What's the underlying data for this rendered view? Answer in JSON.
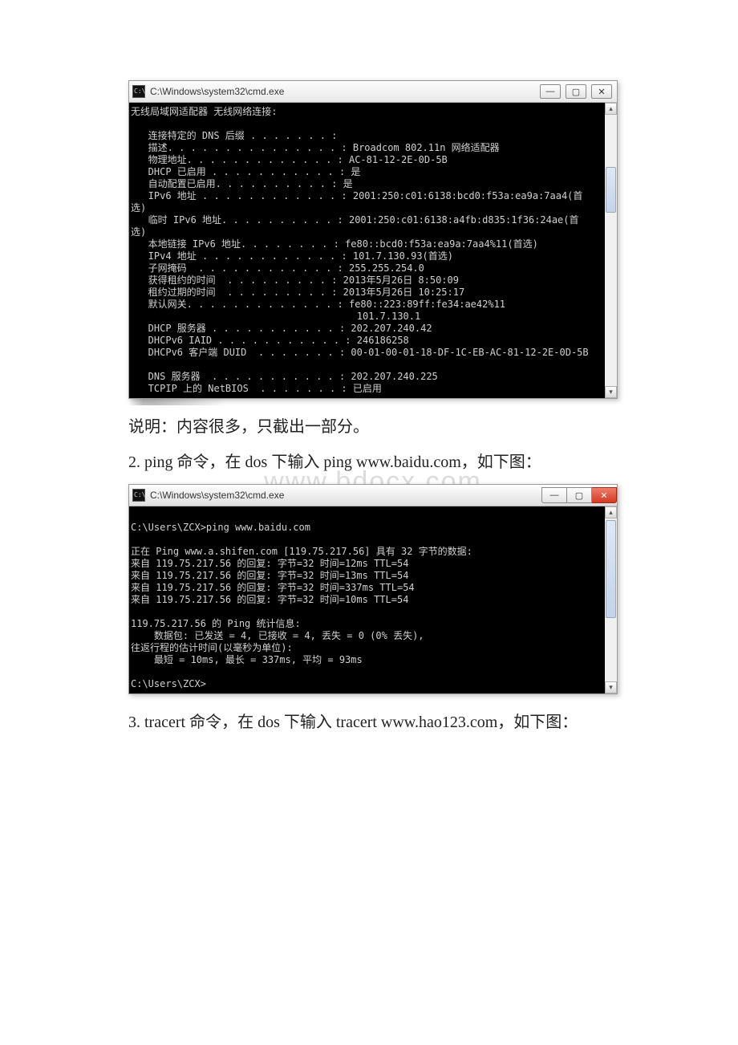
{
  "cmd1": {
    "title": "C:\\Windows\\system32\\cmd.exe",
    "btn_min": "—",
    "btn_max": "▢",
    "btn_close": "✕",
    "scroll_up": "▴",
    "scroll_down": "▾",
    "body": "无线局域网适配器 无线网络连接:\n\n   连接特定的 DNS 后缀 . . . . . . . :\n   描述. . . . . . . . . . . . . . . : Broadcom 802.11n 网络适配器\n   物理地址. . . . . . . . . . . . . : AC-81-12-2E-0D-5B\n   DHCP 已启用 . . . . . . . . . . . : 是\n   自动配置已启用. . . . . . . . . . : 是\n   IPv6 地址 . . . . . . . . . . . . : 2001:250:c01:6138:bcd0:f53a:ea9a:7aa4(首\n选)\n   临时 IPv6 地址. . . . . . . . . . : 2001:250:c01:6138:a4fb:d835:1f36:24ae(首\n选)\n   本地链接 IPv6 地址. . . . . . . . : fe80::bcd0:f53a:ea9a:7aa4%11(首选)\n   IPv4 地址 . . . . . . . . . . . . : 101.7.130.93(首选)\n   子网掩码  . . . . . . . . . . . . : 255.255.254.0\n   获得租约的时间  . . . . . . . . . : 2013年5月26日 8:50:09\n   租约过期的时间  . . . . . . . . . : 2013年5月26日 10:25:17\n   默认网关. . . . . . . . . . . . . : fe80::223:89ff:fe34:ae42%11\n                                       101.7.130.1\n   DHCP 服务器 . . . . . . . . . . . : 202.207.240.42\n   DHCPv6 IAID . . . . . . . . . . . : 246186258\n   DHCPv6 客户端 DUID  . . . . . . . : 00-01-00-01-18-DF-1C-EB-AC-81-12-2E-0D-5B\n\n   DNS 服务器  . . . . . . . . . . . : 202.207.240.225\n   TCPIP 上的 NetBIOS  . . . . . . . : 已启用"
  },
  "note1": "说明：内容很多，只截出一部分。",
  "step2": "2. ping 命令，在 dos 下输入 ping www.baidu.com，如下图：",
  "watermark": "www.bdocx.com",
  "cmd2": {
    "title": "C:\\Windows\\system32\\cmd.exe",
    "btn_min": "—",
    "btn_max": "▢",
    "btn_close": "✕",
    "scroll_up": "▴",
    "scroll_down": "▾",
    "body": "\nC:\\Users\\ZCX>ping www.baidu.com\n\n正在 Ping www.a.shifen.com [119.75.217.56] 具有 32 字节的数据:\n来自 119.75.217.56 的回复: 字节=32 时间=12ms TTL=54\n来自 119.75.217.56 的回复: 字节=32 时间=13ms TTL=54\n来自 119.75.217.56 的回复: 字节=32 时间=337ms TTL=54\n来自 119.75.217.56 的回复: 字节=32 时间=10ms TTL=54\n\n119.75.217.56 的 Ping 统计信息:\n    数据包: 已发送 = 4, 已接收 = 4, 丢失 = 0 (0% 丢失),\n往返行程的估计时间(以毫秒为单位):\n    最短 = 10ms, 最长 = 337ms, 平均 = 93ms\n\nC:\\Users\\ZCX>"
  },
  "step3": "3. tracert 命令，在 dos 下输入 tracert www.hao123.com，如下图："
}
